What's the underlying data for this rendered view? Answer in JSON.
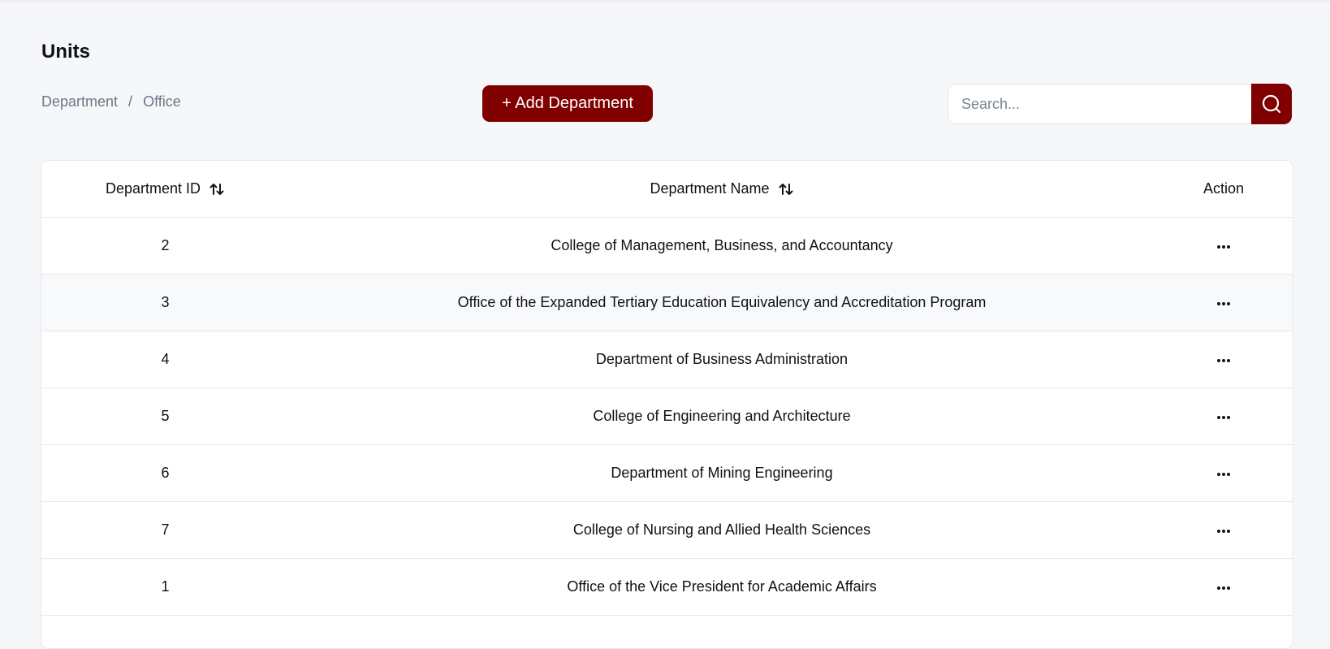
{
  "page": {
    "title": "Units"
  },
  "breadcrumb": {
    "items": [
      "Department",
      "Office"
    ],
    "separator": "/"
  },
  "toolbar": {
    "add_label": "+ Add Department"
  },
  "search": {
    "placeholder": "Search...",
    "value": "",
    "icon": "search-icon"
  },
  "table": {
    "columns": {
      "id": "Department ID",
      "name": "Department Name",
      "action": "Action"
    },
    "sort_icon": "sort-arrows-icon",
    "action_icon": "more-horizontal-icon",
    "rows": [
      {
        "id": "2",
        "name": "College of Management, Business, and Accountancy"
      },
      {
        "id": "3",
        "name": "Office of the Expanded Tertiary Education Equivalency and Accreditation Program"
      },
      {
        "id": "4",
        "name": "Department of Business Administration"
      },
      {
        "id": "5",
        "name": "College of Engineering and Architecture"
      },
      {
        "id": "6",
        "name": "Department of Mining Engineering"
      },
      {
        "id": "7",
        "name": "College of Nursing and Allied Health Sciences"
      },
      {
        "id": "1",
        "name": "Office of the Vice President for Academic Affairs"
      }
    ]
  },
  "colors": {
    "accent": "#800000",
    "background": "#f6f7f9",
    "muted_text": "#6b7787"
  }
}
